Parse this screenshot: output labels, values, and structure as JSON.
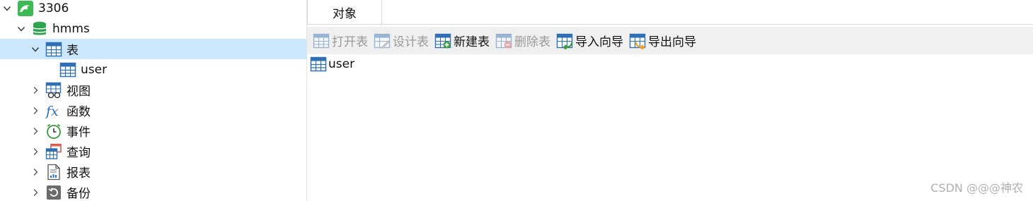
{
  "tree": {
    "connection": {
      "label": "3306",
      "icon": "mysql-dolphin-icon",
      "expanded": true
    },
    "database": {
      "label": "hmms",
      "icon": "database-icon",
      "expanded": true
    },
    "nodes": [
      {
        "label": "表",
        "icon": "table-icon",
        "expanded": true,
        "selected": true
      },
      {
        "label": "user",
        "icon": "table-icon"
      },
      {
        "label": "视图",
        "icon": "view-icon"
      },
      {
        "label": "函数",
        "icon": "function-icon"
      },
      {
        "label": "事件",
        "icon": "event-clock-icon"
      },
      {
        "label": "查询",
        "icon": "query-icon"
      },
      {
        "label": "报表",
        "icon": "report-icon"
      },
      {
        "label": "备份",
        "icon": "backup-icon"
      }
    ]
  },
  "panel": {
    "tab_label": "对象",
    "toolbar": {
      "open_table": "打开表",
      "design_table": "设计表",
      "new_table": "新建表",
      "delete_table": "删除表",
      "import_wizard": "导入向导",
      "export_wizard": "导出向导"
    },
    "objects": [
      {
        "label": "user",
        "icon": "table-icon"
      }
    ]
  },
  "watermark": "CSDN @@@神农",
  "colors": {
    "selection": "#cce8ff",
    "toolbar_bg": "#f0f0f0",
    "table_icon_blue": "#2f6fb5",
    "db_green": "#2ea44f",
    "mysql_green": "#3cba54"
  }
}
